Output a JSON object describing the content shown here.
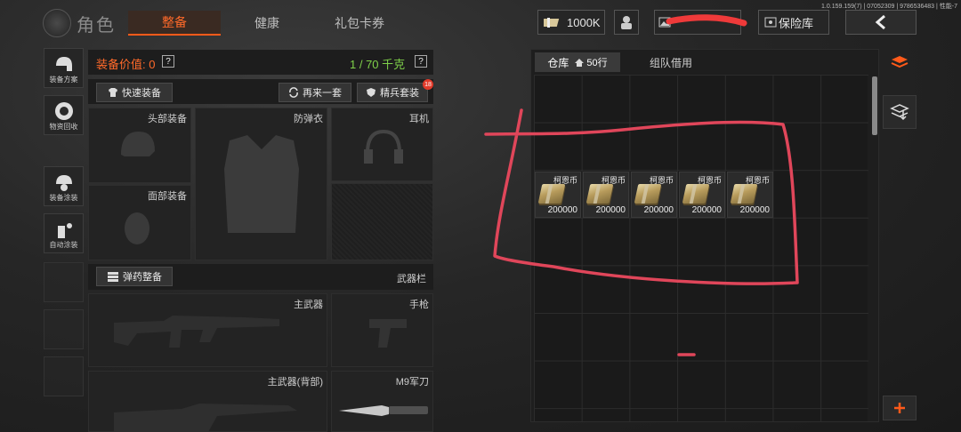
{
  "header": {
    "title": "角色",
    "tabs": [
      {
        "label": "整备",
        "active": true
      },
      {
        "label": "健康",
        "active": false
      },
      {
        "label": "礼包卡券",
        "active": false
      }
    ],
    "currency": "1000K",
    "vault_label": "保险库",
    "version_text": "1.0.159.159(7) | 07052309 | 9786536483 | 性能-7"
  },
  "sidebar": {
    "items": [
      {
        "label": "装备方案"
      },
      {
        "label": "物资回收"
      },
      {
        "label": "装备涂装"
      },
      {
        "label": "自动涂装"
      }
    ]
  },
  "equipment": {
    "value_label": "装备价值: 0",
    "weight_label": "1 / 70 千克",
    "quick_equip": "快速装备",
    "again_label": "再来一套",
    "elite_label": "精兵套装",
    "elite_badge": "18",
    "slots": {
      "head": "头部装备",
      "armor": "防弹衣",
      "earphone": "耳机",
      "face": "面部装备",
      "primary": "主武器",
      "pistol": "手枪",
      "primary_back": "主武器(背部)",
      "knife": "M9军刀"
    },
    "ammo_button": "弹药整备",
    "weapon_bar": "武器栏"
  },
  "warehouse": {
    "tabs": [
      {
        "label": "仓库",
        "extra": "50行",
        "active": true
      },
      {
        "label": "组队借用",
        "active": false
      }
    ],
    "items": [
      {
        "name": "柯恩币",
        "qty": "200000"
      },
      {
        "name": "柯恩币",
        "qty": "200000"
      },
      {
        "name": "柯恩币",
        "qty": "200000"
      },
      {
        "name": "柯恩币",
        "qty": "200000"
      },
      {
        "name": "柯恩币",
        "qty": "200000"
      }
    ]
  },
  "colors": {
    "accent": "#ff5a1a",
    "green": "#7fd14a",
    "annotation": "#e0465a"
  }
}
